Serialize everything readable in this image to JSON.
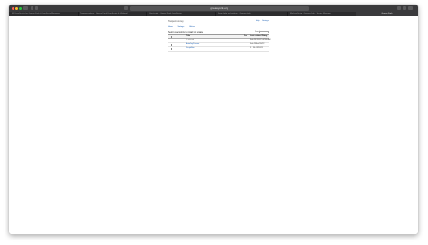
{
  "browser": {
    "address": "greasyfork.org",
    "tabs": [
      {
        "label": "My UserScripts for Greasy Fork & UserScript Managers",
        "active": false
      },
      {
        "label": "Tampermonkey · Greasy Fork: UserScripts & Webmail",
        "active": false
      },
      {
        "label": "UserScript · Greasy Fork: UserScripts",
        "active": false
      },
      {
        "label": "Show help and settings · Greasy Fork",
        "active": false
      },
      {
        "label": "My UserScript · Greasy Fork · Scripts Manager",
        "active": false
      },
      {
        "label": "Greasy Fork",
        "active": true
      }
    ]
  },
  "page": {
    "brand": "Tampermonkey",
    "header_links": [
      "Help",
      "Settings"
    ],
    "tabs": [
      "Home",
      "Settings",
      "Utilities"
    ],
    "select_label": "Select userscripts to install or update",
    "search_label": "Search",
    "table": {
      "headers": {
        "title": "Title",
        "fav": "Fav",
        "updated": "Last updated",
        "rating": "Rating"
      },
      "rows": [
        {
          "title": "",
          "subtitle": "1 selected",
          "fav": "",
          "updated": "Feb 28, 2024 5:47:40 AM",
          "rating": ""
        },
        {
          "title": "AutoPlayPauser",
          "subtitle": "",
          "fav": "",
          "updated": "Feb 28 Sat/20/22",
          "rating": ""
        },
        {
          "title": "ScriptsBox",
          "subtitle": "",
          "fav": "",
          "updated": "5 · 34 d/4/202/1",
          "rating": ""
        }
      ]
    }
  }
}
